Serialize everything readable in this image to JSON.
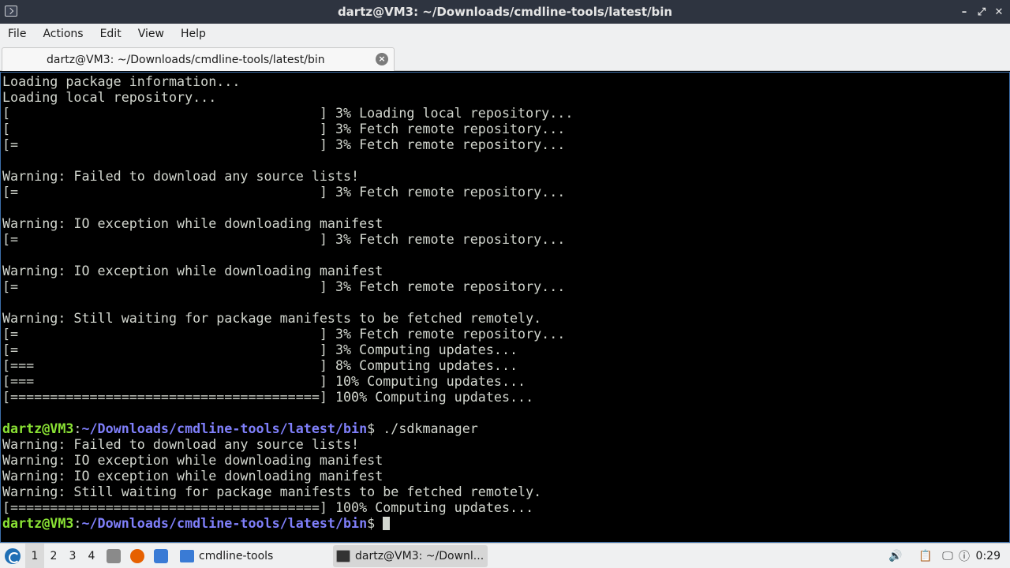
{
  "window": {
    "title": "dartz@VM3: ~/Downloads/cmdline-tools/latest/bin"
  },
  "menu": [
    "File",
    "Actions",
    "Edit",
    "View",
    "Help"
  ],
  "tab": {
    "label": "dartz@VM3: ~/Downloads/cmdline-tools/latest/bin",
    "close_glyph": "×"
  },
  "terminal": {
    "lines": [
      "Loading package information...",
      "Loading local repository...",
      "[                                       ] 3% Loading local repository...",
      "[                                       ] 3% Fetch remote repository...",
      "[=                                      ] 3% Fetch remote repository...",
      "",
      "Warning: Failed to download any source lists!",
      "[=                                      ] 3% Fetch remote repository...",
      "",
      "Warning: IO exception while downloading manifest",
      "[=                                      ] 3% Fetch remote repository...",
      "",
      "Warning: IO exception while downloading manifest",
      "[=                                      ] 3% Fetch remote repository...",
      "",
      "Warning: Still waiting for package manifests to be fetched remotely.",
      "[=                                      ] 3% Fetch remote repository...",
      "[=                                      ] 3% Computing updates...",
      "[===                                    ] 8% Computing updates...",
      "[===                                    ] 10% Computing updates...",
      "[=======================================] 100% Computing updates...",
      "",
      "PROMPT1",
      "Warning: Failed to download any source lists!",
      "Warning: IO exception while downloading manifest",
      "Warning: IO exception while downloading manifest",
      "Warning: Still waiting for package manifests to be fetched remotely.",
      "[=======================================] 100% Computing updates...",
      "PROMPT2"
    ],
    "prompt": {
      "user": "dartz@VM3",
      "sep": ":",
      "path": "~/Downloads/cmdline-tools/latest/bin",
      "symbol": "$ "
    },
    "command": "./sdkmanager"
  },
  "taskbar": {
    "workspaces": [
      "1",
      "2",
      "3",
      "4"
    ],
    "active_workspace": "1",
    "tasks": [
      {
        "label": "cmdline-tools",
        "icon": "folder-icon"
      },
      {
        "label": "dartz@VM3: ~/Downl...",
        "icon": "terminal-icon"
      }
    ],
    "clock": "0:29"
  },
  "colors": {
    "prompt_user": "#8ae234",
    "prompt_path": "#7f7ffa",
    "terminal_text": "#d3d7cf",
    "titlebar": "#2e3440"
  }
}
